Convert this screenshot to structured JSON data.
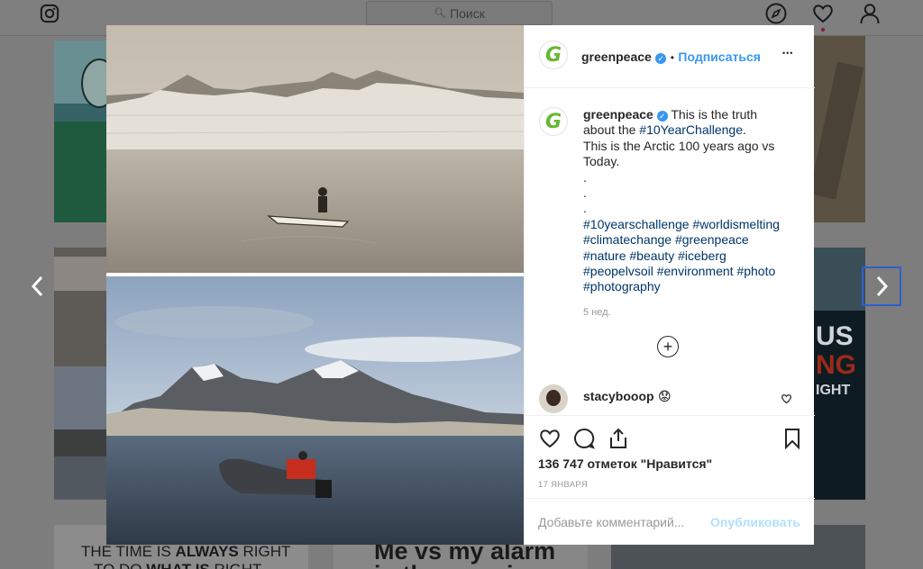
{
  "topbar": {
    "search_placeholder": "Поиск",
    "icons": [
      "instagram-logo-icon",
      "search-icon",
      "compass-icon",
      "heart-icon",
      "profile-icon"
    ]
  },
  "background": {
    "tile_text_1a_pre": "THE TIME IS ",
    "tile_text_1a_bold": "ALWAYS",
    "tile_text_1a_post": " RIGHT",
    "tile_text_1b_pre": "TO DO ",
    "tile_text_1b_bold": "WHAT IS",
    "tile_text_1b_post": " RIGHT",
    "tile_text_2a": "Me vs my alarm",
    "tile_text_2b": "in the morning",
    "tile_text_3a": "US",
    "tile_text_3b": "NG",
    "tile_text_3c": "IGHT"
  },
  "post": {
    "username": "greenpeace",
    "follow_label": "Подписаться",
    "separator": "•",
    "more_label": "•••",
    "caption_text_1": "This is the truth",
    "caption_text_2": "about the",
    "caption_tag_1": "#10YearChallenge",
    "caption_text_3": ".",
    "caption_line_3": "This is the Arctic 100 years ago vs",
    "caption_line_4": "Today.",
    "caption_dot": ".",
    "hashtag_lines": [
      "#10yearschallenge #worldismelting",
      "#climatechange #greenpeace",
      "#nature #beauty #iceberg",
      "#peopelvsoil #environment #photo",
      "#photography"
    ],
    "age": "5 нед.",
    "load_more_label": "+",
    "comment_user": "stacybooop",
    "comment_emoji": "😟",
    "likes": "136 747 отметок \"Нравится\"",
    "date": "17 ЯНВАРЯ",
    "comment_placeholder": "Добавьте комментарий...",
    "publish_label": "Опубликовать",
    "avatar_letter": "G"
  },
  "colors": {
    "accent": "#3897f0",
    "hashtag": "#003569",
    "brand_green": "#67b832",
    "overlay": "#7d7d7d"
  }
}
